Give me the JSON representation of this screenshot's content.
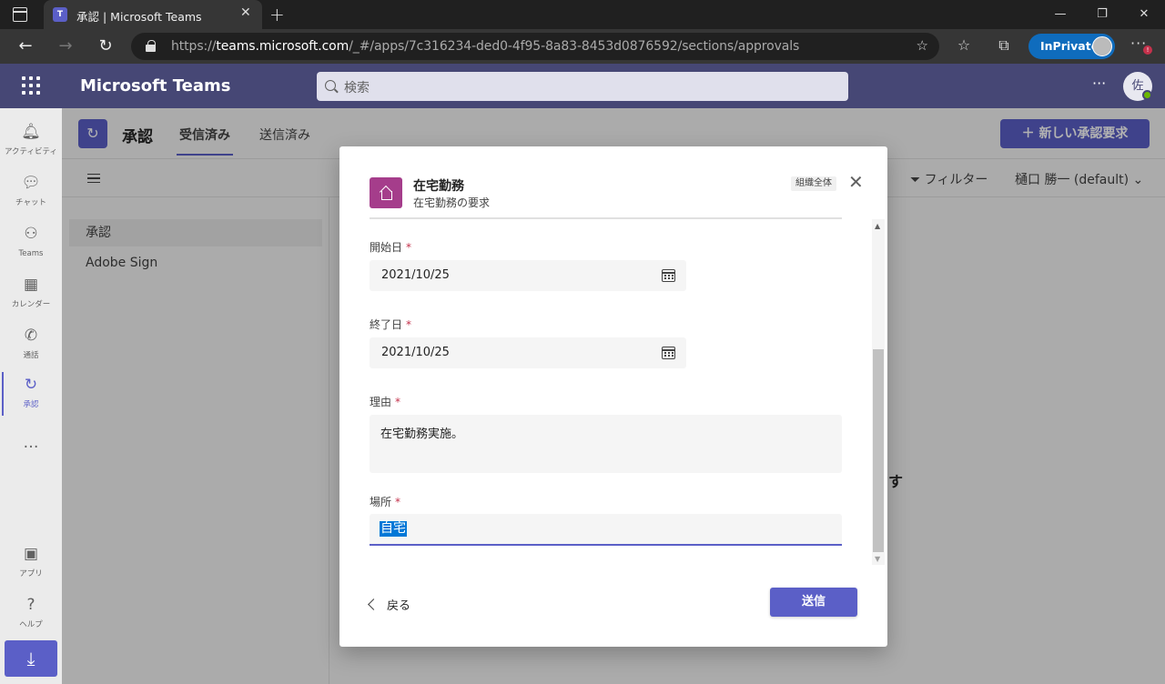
{
  "browser": {
    "tab_title": "承認 | Microsoft Teams",
    "tab_favicon": "T",
    "url_prefix": "https://",
    "url_host": "teams.microsoft.com",
    "url_path": "/_#/apps/7c316234-ded0-4f95-8a83-8453d0876592/sections/approvals",
    "inprivate_label": "InPrivate",
    "notification_badge": "!"
  },
  "teams_header": {
    "app_title": "Microsoft Teams",
    "search_placeholder": "検索",
    "avatar_initial": "佐"
  },
  "rail": {
    "items": [
      {
        "label": "アクティビティ",
        "icon": "bell-icon"
      },
      {
        "label": "チャット",
        "icon": "chat-icon"
      },
      {
        "label": "Teams",
        "icon": "teams-icon"
      },
      {
        "label": "カレンダー",
        "icon": "calendar-icon"
      },
      {
        "label": "通話",
        "icon": "phone-icon"
      },
      {
        "label": "承認",
        "icon": "approvals-icon"
      }
    ],
    "more_label": "…",
    "apps_label": "アプリ",
    "help_label": "ヘルプ"
  },
  "approvals_app": {
    "name": "承認",
    "tabs": [
      {
        "label": "受信済み",
        "selected": true
      },
      {
        "label": "送信済み",
        "selected": false
      }
    ],
    "new_request_label": "新しい承認要求",
    "filter_label": "フィルター",
    "owner_label": "樋口 勝一 (default)",
    "side_items": [
      "承認",
      "Adobe Sign"
    ],
    "empty_message_fragment": "ます"
  },
  "dialog": {
    "title": "在宅勤務",
    "subtitle": "在宅勤務の要求",
    "org_badge": "組織全体",
    "fields": {
      "start_label": "開始日",
      "start_value": "2021/10/25",
      "end_label": "終了日",
      "end_value": "2021/10/25",
      "reason_label": "理由",
      "reason_value": "在宅勤務実施。",
      "location_label": "場所",
      "location_value": "自宅",
      "required_mark": "*"
    },
    "back_label": "戻る",
    "submit_label": "送信"
  },
  "colors": {
    "brand": "#5b5fc7",
    "header": "#464775",
    "template_icon": "#a53d8b",
    "required": "#c4314b"
  }
}
